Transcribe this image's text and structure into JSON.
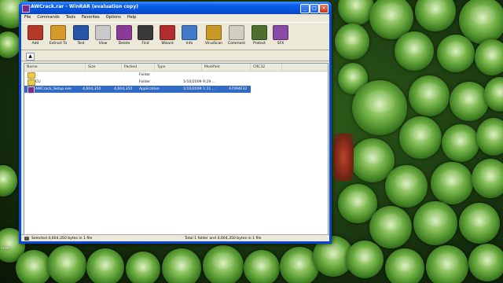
{
  "window": {
    "title": "AWCrack.rar - WinRAR (evaluation copy)"
  },
  "menu": [
    "File",
    "Commands",
    "Tools",
    "Favorites",
    "Options",
    "Help"
  ],
  "toolbar": [
    {
      "label": "Add",
      "icon": "add-archive-icon",
      "color": "#b5392a"
    },
    {
      "label": "Extract To",
      "icon": "extract-to-icon",
      "color": "#d59a2a"
    },
    {
      "label": "Test",
      "icon": "test-icon",
      "color": "#2855a8"
    },
    {
      "label": "View",
      "icon": "view-icon",
      "color": "#c9c9c9"
    },
    {
      "label": "Delete",
      "icon": "delete-icon",
      "color": "#8a3b9a"
    },
    {
      "label": "Find",
      "icon": "find-icon",
      "color": "#3a3a3a"
    },
    {
      "label": "Wizard",
      "icon": "wizard-icon",
      "color": "#b22e2e"
    },
    {
      "label": "Info",
      "icon": "info-icon",
      "color": "#3f7bc9"
    },
    {
      "label": "VirusScan",
      "icon": "virusscan-icon",
      "color": "#c99a24"
    },
    {
      "label": "Comment",
      "icon": "comment-icon",
      "color": "#d0d0c0"
    },
    {
      "label": "Protect",
      "icon": "protect-icon",
      "color": "#4e6e2e"
    },
    {
      "label": "SFX",
      "icon": "sfx-icon",
      "color": "#8a4aa8"
    }
  ],
  "columns": [
    "Name",
    "Size",
    "Packed",
    "Type",
    "Modified",
    "CRC32"
  ],
  "files": [
    {
      "name": "..",
      "size": "",
      "packed": "",
      "type": "Folder",
      "modified": "",
      "crc": "",
      "icon": "folder-icon"
    },
    {
      "name": "CU",
      "size": "",
      "packed": "",
      "type": "Folder",
      "modified": "1/10/2009 9:29 ...",
      "crc": "",
      "icon": "folder-icon"
    },
    {
      "name": "AWCrack_Setup.exe",
      "size": "4,604,350",
      "packed": "4,604,350",
      "type": "Application",
      "modified": "1/10/2009 1:11 ...",
      "crc": "A7094F32",
      "icon": "app-icon",
      "selected": true
    }
  ],
  "status": {
    "left": "Selected 4,604,350 bytes in 1 file",
    "right": "Total 1 folder and 4,604,350 bytes in 1 file"
  },
  "desktop": {
    "icon_label": "icon"
  }
}
